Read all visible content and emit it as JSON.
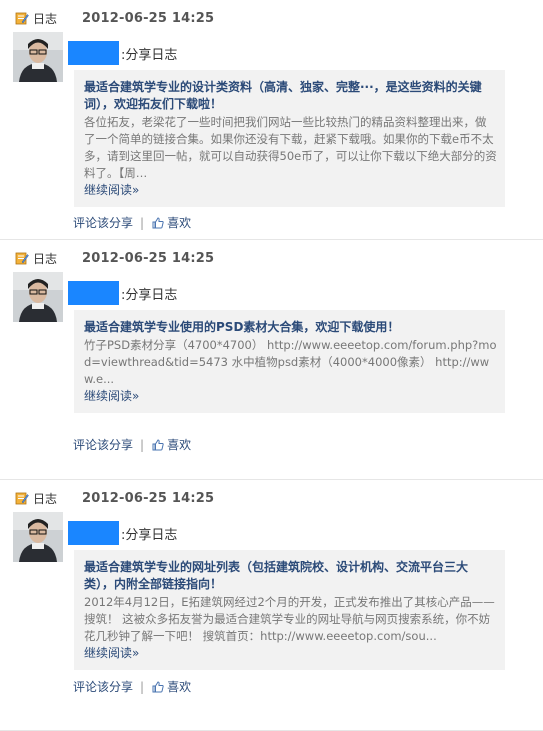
{
  "entries": [
    {
      "type_label": "日志",
      "timestamp": "2012-06-25 14:25",
      "share_label": ":分享日志",
      "card_title": "最适合建筑学专业的设计类资料（高清、独家、完整···，是这些资料的关键词），欢迎拓友们下载啦！",
      "card_body": "各位拓友，老梁花了一些时间把我们网站一些比较热门的精品资料整理出来，做了一个简单的链接合集。如果你还没有下载，赶紧下载哦。如果你的下载e币不太多，请到这里回一帖，就可以自动获得50e币了，可以让你下载以下绝大部分的资料了。【周…",
      "read_more": "继续阅读»",
      "comment_share": "评论该分享",
      "separator": "|",
      "like": "喜欢"
    },
    {
      "type_label": "日志",
      "timestamp": "2012-06-25 14:25",
      "share_label": ":分享日志",
      "card_title": "最适合建筑学专业使用的PSD素材大合集，欢迎下载使用！",
      "card_body": "竹子PSD素材分享（4700*4700） http://www.eeeetop.com/forum.php?mod=viewthread&tid=5473 水中植物psd素材（4000*4000像素） http://www.e...",
      "read_more": "继续阅读»",
      "comment_share": "评论该分享",
      "separator": "|",
      "like": "喜欢"
    },
    {
      "type_label": "日志",
      "timestamp": "2012-06-25 14:25",
      "share_label": ":分享日志",
      "card_title": "最适合建筑学专业的网址列表（包括建筑院校、设计机构、交流平台三大类），内附全部链接指向！",
      "card_body": "2012年4月12日，E拓建筑网经过2个月的开发，正式发布推出了其核心产品——搜筑！ 这被众多拓友誉为最适合建筑学专业的网址导航与网页搜索系统，你不妨花几秒钟了解一下吧！ 搜筑首页：http://www.eeeetop.com/sou...",
      "read_more": "继续阅读»",
      "comment_share": "评论该分享",
      "separator": "|",
      "like": "喜欢"
    }
  ],
  "colors": {
    "link": "#2b4a78",
    "card_bg": "#f2f2f2",
    "user_mask": "#1a86ff",
    "timestamp": "#555555"
  },
  "icons": {
    "type_icon": "blog-edit-icon",
    "like_icon": "thumbs-up-icon"
  }
}
